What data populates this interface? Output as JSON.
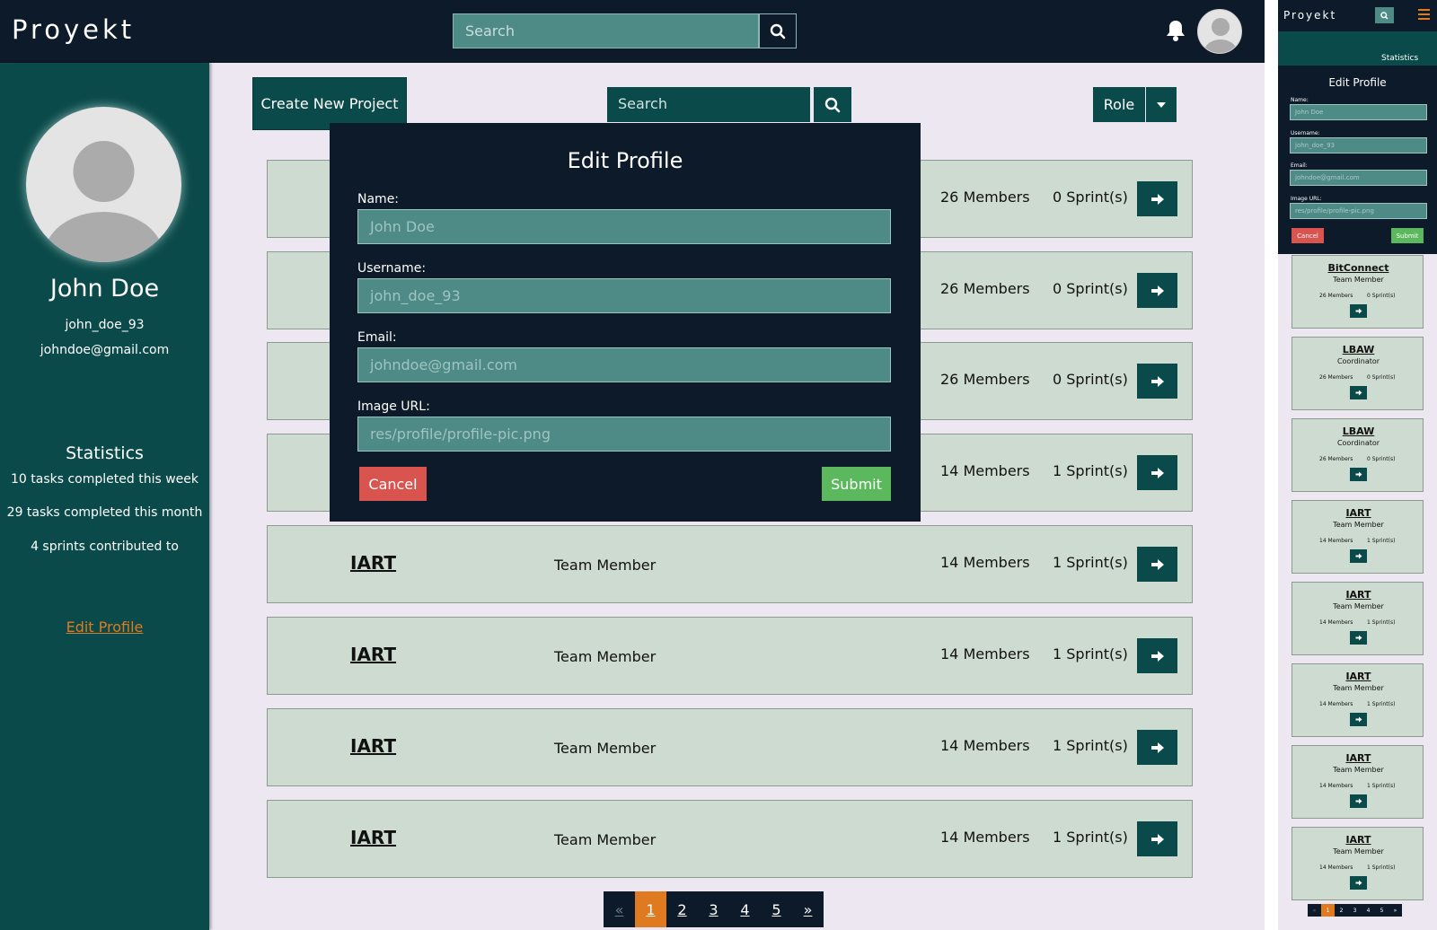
{
  "app": {
    "logo": "Proyekt"
  },
  "header": {
    "search_placeholder": "Search"
  },
  "profile": {
    "name": "John Doe",
    "username": "john_doe_93",
    "email": "johndoe@gmail.com",
    "statistics_title": "Statistics",
    "stats": [
      "10 tasks completed this week",
      "29 tasks completed this month",
      "4 sprints contributed to"
    ],
    "edit_link": "Edit Profile"
  },
  "toolbar": {
    "create_label": "Create New Project",
    "search_placeholder": "Search",
    "role_label": "Role"
  },
  "projects": [
    {
      "name": "BitConnect",
      "role": "Team Member",
      "members": "26 Members",
      "sprints": "0 Sprint(s)"
    },
    {
      "name": "LBAW",
      "role": "Coordinator",
      "members": "26 Members",
      "sprints": "0 Sprint(s)"
    },
    {
      "name": "LBAW",
      "role": "Coordinator",
      "members": "26 Members",
      "sprints": "0 Sprint(s)"
    },
    {
      "name": "IART",
      "role": "Team Member",
      "members": "14 Members",
      "sprints": "1 Sprint(s)"
    },
    {
      "name": "IART",
      "role": "Team Member",
      "members": "14 Members",
      "sprints": "1 Sprint(s)"
    },
    {
      "name": "IART",
      "role": "Team Member",
      "members": "14 Members",
      "sprints": "1 Sprint(s)"
    },
    {
      "name": "IART",
      "role": "Team Member",
      "members": "14 Members",
      "sprints": "1 Sprint(s)"
    },
    {
      "name": "IART",
      "role": "Team Member",
      "members": "14 Members",
      "sprints": "1 Sprint(s)"
    }
  ],
  "pagination": {
    "prev": "«",
    "pages": [
      "1",
      "2",
      "3",
      "4",
      "5"
    ],
    "next": "»",
    "active": "1"
  },
  "modal": {
    "title": "Edit Profile",
    "name_label": "Name:",
    "name_value": "John Doe",
    "username_label": "Username:",
    "username_value": "john_doe_93",
    "email_label": "Email:",
    "email_value": "johndoe@gmail.com",
    "image_label": "Image URL:",
    "image_value": "res/profile/profile-pic.png",
    "cancel_label": "Cancel",
    "submit_label": "Submit"
  },
  "colors": {
    "topbar": "#0d1a2a",
    "sidebar": "#0b4a4a",
    "accent": "#e07a20",
    "cancel": "#d9534f",
    "submit": "#5cb85c",
    "row": "#cddbd0"
  },
  "icons": [
    "search-icon",
    "bell-icon",
    "avatar-icon",
    "caret-down-icon",
    "enter-icon",
    "menu-icon"
  ]
}
